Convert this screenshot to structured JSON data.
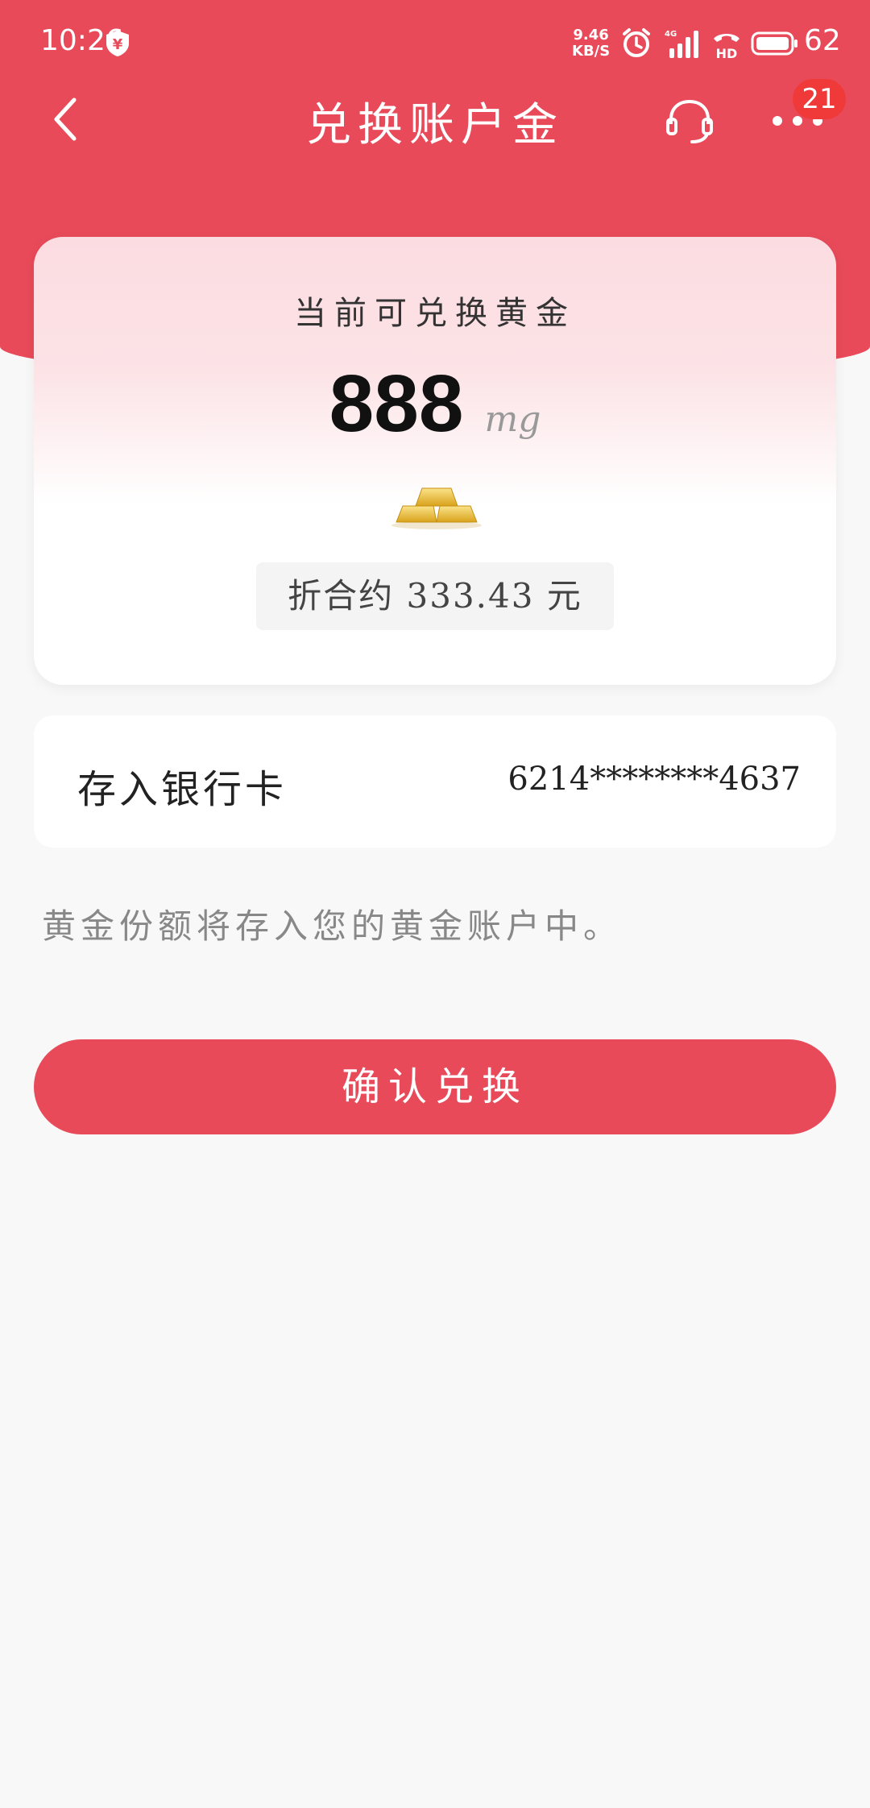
{
  "status_bar": {
    "time": "10:26",
    "net_speed_value": "9.46",
    "net_speed_unit": "KB/S",
    "network": "4G",
    "hd": "HD",
    "battery": "62"
  },
  "nav": {
    "title": "兑换账户金",
    "badge_count": "21"
  },
  "gold_card": {
    "title": "当前可兑换黄金",
    "amount": "888",
    "unit": "mg",
    "approx_text": "折合约 333.43 元"
  },
  "bank": {
    "label": "存入银行卡",
    "card_number": "6214********4637"
  },
  "note": "黄金份额将存入您的黄金账户中。",
  "confirm_button": "确认兑换",
  "colors": {
    "primary": "#e84a59",
    "background": "#f8f8f8",
    "badge": "#f03a3a"
  }
}
